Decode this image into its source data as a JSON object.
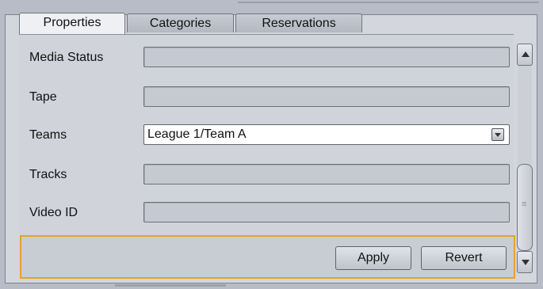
{
  "tabs": {
    "properties": "Properties",
    "categories": "Categories",
    "reservations": "Reservations"
  },
  "fields": {
    "media_status": {
      "label": "Media Status",
      "value": ""
    },
    "tape": {
      "label": "Tape",
      "value": ""
    },
    "teams": {
      "label": "Teams",
      "value": "League 1/Team A"
    },
    "tracks": {
      "label": "Tracks",
      "value": ""
    },
    "video_id": {
      "label": "Video ID",
      "value": ""
    }
  },
  "buttons": {
    "apply": "Apply",
    "revert": "Revert"
  },
  "icons": {
    "dropdown": "chevron-down-icon",
    "scroll_up": "arrow-up-icon",
    "scroll_down": "arrow-down-icon"
  },
  "colors": {
    "focus_border": "#e5a32b",
    "panel_bg": "#d3d6dc"
  }
}
